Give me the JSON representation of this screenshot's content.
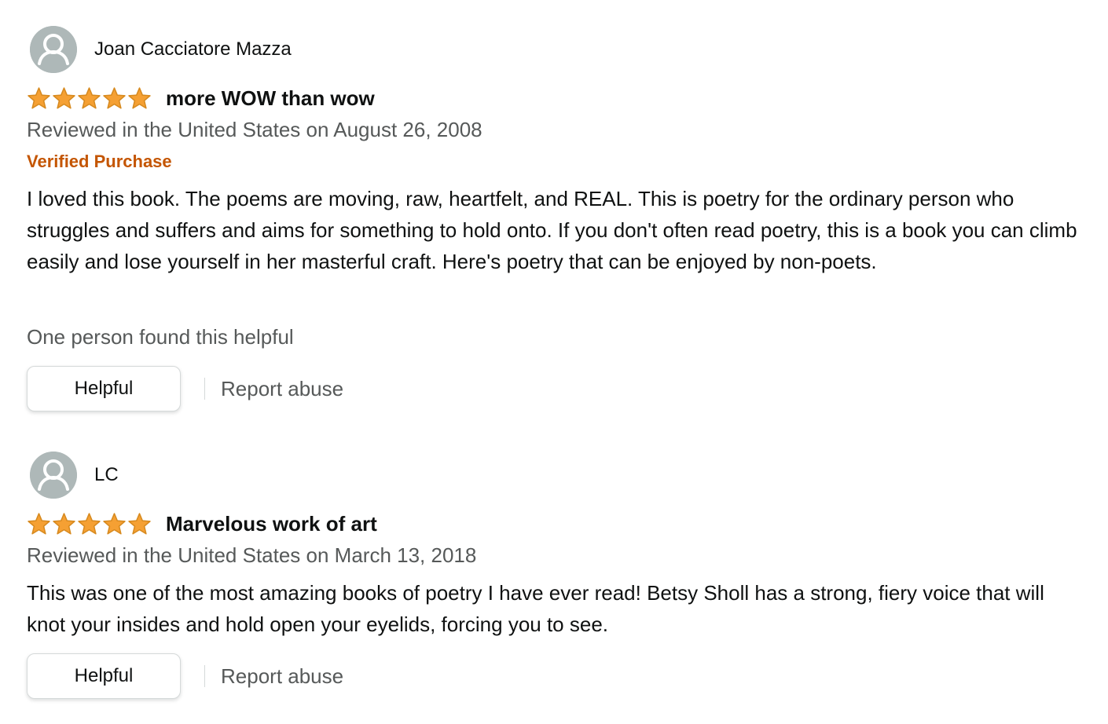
{
  "colors": {
    "star": "#f5a033",
    "star_outline": "#d78a1f",
    "verified": "#c45500",
    "secondary_text": "#565959",
    "primary_text": "#0f1111",
    "avatar_bg": "#aeb8b8"
  },
  "reviews": [
    {
      "author": "Joan Cacciatore Mazza",
      "avatar_icon": "default-user-avatar-icon",
      "rating": 5,
      "rating_max": 5,
      "title": "more WOW than wow",
      "date": "Reviewed in the United States on August 26, 2008",
      "badge": "Verified Purchase",
      "body": "I loved this book. The poems are moving, raw, heartfelt, and REAL. This is poetry for the ordinary person who struggles and suffers and aims for something to hold onto. If you don't often read poetry, this is a book you can climb easily and lose yourself in her masterful craft. Here's poetry that can be enjoyed by non-poets.",
      "helpful_count": "One person found this helpful",
      "helpful_label": "Helpful",
      "report_label": "Report abuse"
    },
    {
      "author": "LC",
      "avatar_icon": "default-user-avatar-icon",
      "rating": 5,
      "rating_max": 5,
      "title": "Marvelous work of art",
      "date": "Reviewed in the United States on March 13, 2018",
      "body": "This was one of the most amazing books of poetry I have ever read! Betsy Sholl has a strong, fiery voice that will knot your insides and hold open your eyelids, forcing you to see.",
      "helpful_label": "Helpful",
      "report_label": "Report abuse"
    }
  ]
}
